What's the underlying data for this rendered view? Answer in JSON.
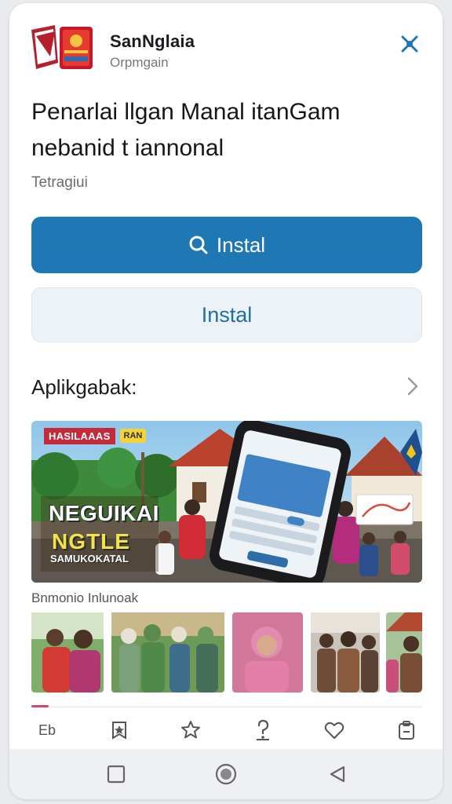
{
  "developer": {
    "name": "SanNglaia",
    "subtitle": "Orpmgain"
  },
  "app": {
    "title_line1": "Penarlai llgan Manal itanGam",
    "title_line2": "nebanid t iannonal",
    "meta": "Tetragiui"
  },
  "buttons": {
    "primary_label": "Instal",
    "secondary_label": "Instal"
  },
  "section": {
    "title": "Aplikgabak:"
  },
  "hero": {
    "badge_text": "HASILAAAS",
    "badge_tag": "RAN",
    "headline": "NEGUIKAI",
    "headline2": "NGTLE",
    "small_text": "SAMUKOKATAL"
  },
  "screenshots": {
    "label": "Bnmonio Inlunoak"
  },
  "nav": {
    "first_label": "Eb"
  },
  "colors": {
    "primary": "#1f78b4",
    "secondary_bg": "#edf2f7",
    "secondary_text": "#1f6fa6",
    "accent": "#d2496a"
  }
}
